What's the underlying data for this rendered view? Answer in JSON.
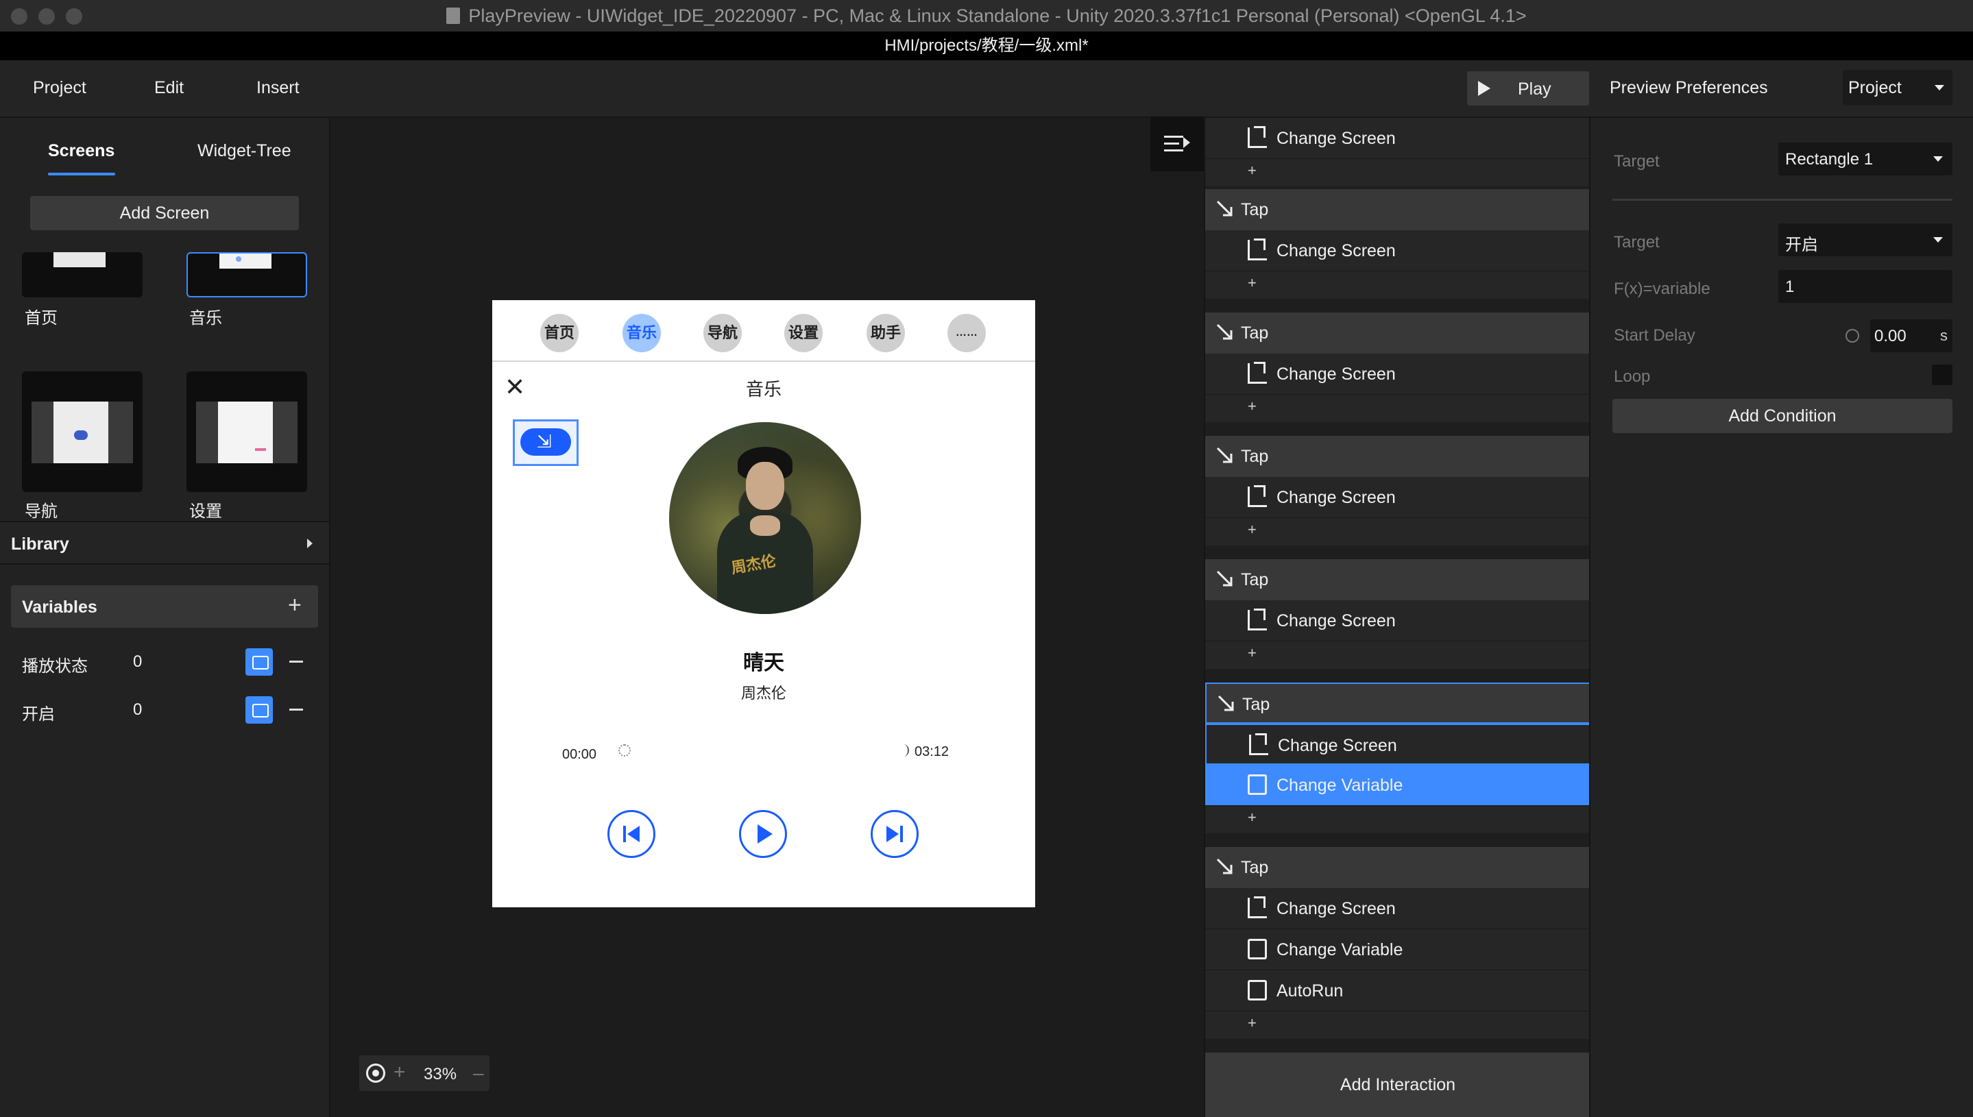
{
  "window": {
    "title": "PlayPreview - UIWidget_IDE_20220907 - PC, Mac & Linux Standalone - Unity 2020.3.37f1c1 Personal (Personal) <OpenGL 4.1>",
    "path": "HMI/projects/教程/一级.xml*"
  },
  "menu": {
    "project": "Project",
    "edit": "Edit",
    "insert": "Insert"
  },
  "toolbar": {
    "play_label": "Play",
    "preview_preferences": "Preview Preferences",
    "scope_dropdown": "Project"
  },
  "left_panel": {
    "tabs": {
      "screens": "Screens",
      "widget_tree": "Widget-Tree"
    },
    "add_screen": "Add Screen",
    "screens": [
      {
        "label": "首页"
      },
      {
        "label": "音乐"
      },
      {
        "label": "导航"
      },
      {
        "label": "设置"
      }
    ],
    "library": "Library",
    "variables_title": "Variables",
    "variables": [
      {
        "name": "播放状态",
        "value": "0"
      },
      {
        "name": "开启",
        "value": "0"
      }
    ]
  },
  "device": {
    "nav": [
      "首页",
      "音乐",
      "导航",
      "设置",
      "助手",
      "……"
    ],
    "title": "音乐",
    "song": "晴天",
    "artist": "周杰伦",
    "time_start": "00:00",
    "time_end": "03:12",
    "album_mark": "周杰伦"
  },
  "zoom": {
    "value": "33%"
  },
  "interactions": {
    "top_action": "Change Screen",
    "groups": [
      {
        "trigger": "Tap",
        "actions": [
          "Change Screen"
        ]
      },
      {
        "trigger": "Tap",
        "actions": [
          "Change Screen"
        ]
      },
      {
        "trigger": "Tap",
        "actions": [
          "Change Screen"
        ]
      },
      {
        "trigger": "Tap",
        "actions": [
          "Change Screen"
        ]
      },
      {
        "trigger": "Tap",
        "actions": [
          "Change Screen",
          "Change Variable"
        ]
      },
      {
        "trigger": "Tap",
        "actions": [
          "Change Screen",
          "Change Variable",
          "AutoRun"
        ]
      }
    ],
    "add_symbol": "+",
    "add_interaction": "Add Interaction"
  },
  "properties": {
    "target_label": "Target",
    "target_value": "Rectangle 1",
    "target2_label": "Target",
    "target2_value": "开启",
    "fx_label": "F(x)=variable",
    "fx_value": "1",
    "start_delay_label": "Start Delay",
    "start_delay_value": "0.00",
    "start_delay_unit": "s",
    "loop_label": "Loop",
    "add_condition": "Add Condition"
  },
  "colors": {
    "accent": "#3d8bff",
    "device_accent": "#1a5cff",
    "panel": "#222222"
  }
}
